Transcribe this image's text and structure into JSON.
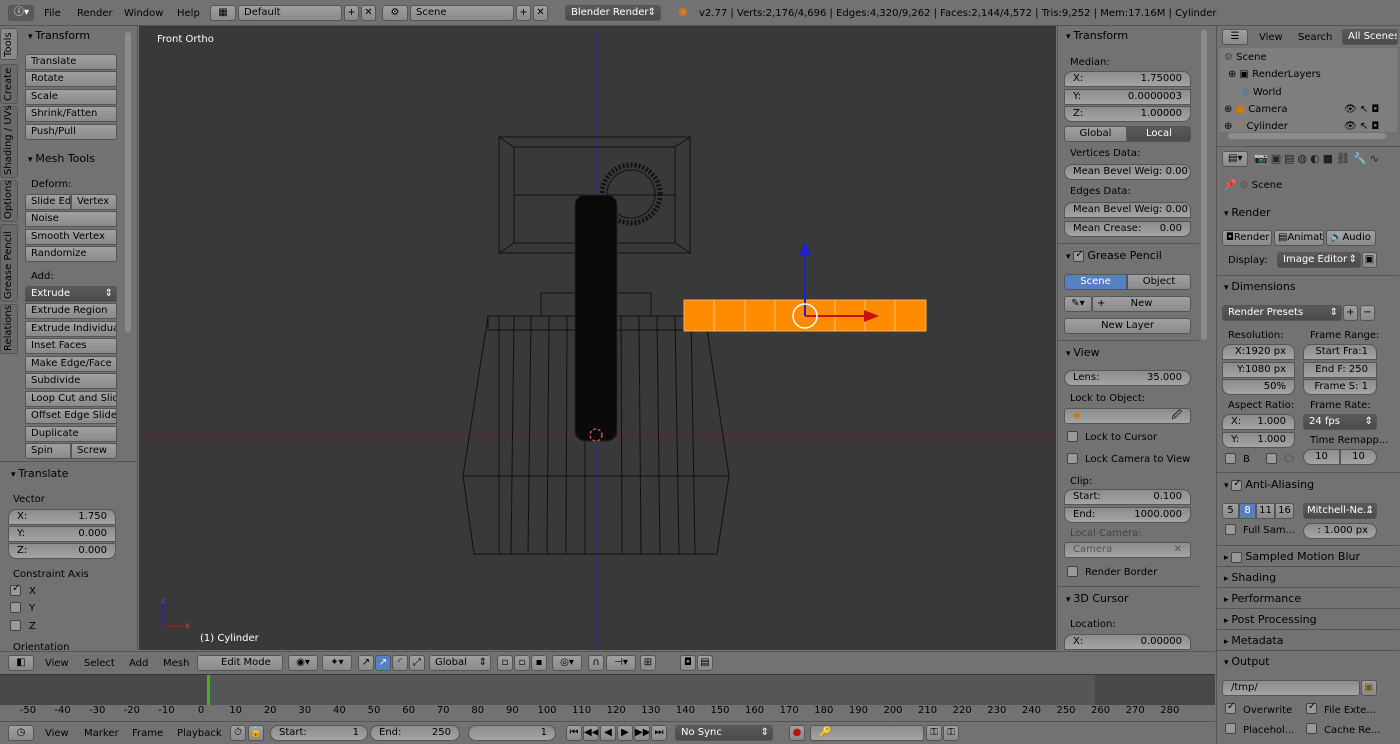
{
  "topbar": {
    "menus": [
      "File",
      "Render",
      "Window",
      "Help"
    ],
    "layout": "Default",
    "scene": "Scene",
    "engine": "Blender Render",
    "stats": "v2.77 | Verts:2,176/4,696 | Edges:4,320/9,262 | Faces:2,144/4,572 | Tris:9,252 | Mem:17.16M | Cylinder"
  },
  "tabs": [
    "Tools",
    "Create",
    "Shading / UVs",
    "Options",
    "Grease Pencil",
    "Relations"
  ],
  "tools": {
    "transform_title": "Transform",
    "transform_buttons": [
      "Translate",
      "Rotate",
      "Scale",
      "Shrink/Fatten",
      "Push/Pull"
    ],
    "mesh_title": "Mesh Tools",
    "deform_label": "Deform:",
    "slide_edge": "Slide Ed",
    "vertex": "Vertex",
    "noise": "Noise",
    "smooth": "Smooth Vertex",
    "randomize": "Randomize",
    "add_label": "Add:",
    "extrude": "Extrude",
    "add_buttons": [
      "Extrude Region",
      "Extrude Individual",
      "Inset Faces",
      "Make Edge/Face",
      "Subdivide",
      "Loop Cut and Slide",
      "Offset Edge Slide",
      "Duplicate"
    ],
    "spin": "Spin",
    "screw": "Screw"
  },
  "operator": {
    "title": "Translate",
    "vector_label": "Vector",
    "x_label": "X:",
    "x": "1.750",
    "y_label": "Y:",
    "y": "0.000",
    "z_label": "Z:",
    "z": "0.000",
    "constraint_label": "Constraint Axis",
    "cx": "X",
    "cy": "Y",
    "cz": "Z",
    "orientation": "Orientation"
  },
  "viewport": {
    "view_name": "Front Ortho",
    "object_label": "(1) Cylinder",
    "axis_z": "z",
    "axis_x": "x"
  },
  "viewheader": {
    "menus": [
      "View",
      "Select",
      "Add",
      "Mesh"
    ],
    "mode": "Edit Mode",
    "orientation": "Global"
  },
  "props": {
    "transform_title": "Transform",
    "median": "Median:",
    "x_label": "X:",
    "x": "1.75000",
    "y_label": "Y:",
    "y": "0.0000003",
    "z_label": "Z:",
    "z": "1.00000",
    "global": "Global",
    "local": "Local",
    "vertices_data": "Vertices Data:",
    "mean_bevel_v": "Mean Bevel Weig: 0.00",
    "edges_data": "Edges Data:",
    "mean_bevel_e": "Mean Bevel Weig: 0.00",
    "mean_crease_label": "Mean Crease:",
    "mean_crease": "0.00",
    "grease_title": "Grease Pencil",
    "scene_btn": "Scene",
    "object_btn": "Object",
    "new": "New",
    "new_layer": "New Layer",
    "view_title": "View",
    "lens_label": "Lens:",
    "lens": "35.000",
    "lock_object": "Lock to Object:",
    "lock_cursor": "Lock to Cursor",
    "lock_camera": "Lock Camera to View",
    "clip": "Clip:",
    "start_label": "Start:",
    "start": "0.100",
    "end_label": "End:",
    "end": "1000.000",
    "local_camera": "Local Camera:",
    "camera": "Camera",
    "render_border": "Render Border",
    "cursor_title": "3D Cursor",
    "location": "Location:",
    "cx_label": "X:",
    "cx": "0.00000"
  },
  "outliner": {
    "menus": [
      "View",
      "Search"
    ],
    "all_scenes": "All Scenes",
    "items": [
      "Scene",
      "RenderLayers",
      "World",
      "Camera",
      "Cylinder"
    ]
  },
  "render": {
    "scene": "Scene",
    "render_title": "Render",
    "render_btn": "Render",
    "anim_btn": "Animati",
    "audio_btn": "Audio",
    "display_label": "Display:",
    "display": "Image Editor",
    "dimensions_title": "Dimensions",
    "presets": "Render Presets",
    "resolution": "Resolution:",
    "res_x": "X:1920 px",
    "res_y": "Y:1080 px",
    "res_pct": "50%",
    "frame_range": "Frame Range:",
    "start_frame": "Start Fra:1",
    "end_frame": "End F: 250",
    "frame_step": "Frame S: 1",
    "aspect": "Aspect Ratio:",
    "asp_x_label": "X:",
    "asp_x": "1.000",
    "asp_y_label": "Y:",
    "asp_y": "1.000",
    "frame_rate": "Frame Rate:",
    "fps": "24 fps",
    "time_remap": "Time Remapp...",
    "remap_old": "10",
    "remap_new": "10",
    "b": "B",
    "cr": "Cr",
    "aa_title": "Anti-Aliasing",
    "aa_samples": [
      "5",
      "8",
      "11",
      "16"
    ],
    "aa_filter": "Mitchell-Ne...",
    "full_sample": "Full Sam...",
    "filter_size": ": 1.000 px",
    "smb": "Sampled Motion Blur",
    "shading": "Shading",
    "performance": "Performance",
    "post": "Post Processing",
    "metadata": "Metadata",
    "output": "Output",
    "path": "/tmp/",
    "overwrite": "Overwrite",
    "file_ext": "File Exte...",
    "placeholders": "Placehol...",
    "cache": "Cache Re..."
  },
  "timeline": {
    "ticks": [
      "-50",
      "-40",
      "-30",
      "-20",
      "-10",
      "0",
      "10",
      "20",
      "30",
      "40",
      "50",
      "60",
      "70",
      "80",
      "90",
      "100",
      "110",
      "120",
      "130",
      "140",
      "150",
      "160",
      "170",
      "180",
      "190",
      "200",
      "210",
      "220",
      "230",
      "240",
      "250",
      "260",
      "270",
      "280"
    ],
    "menus": [
      "View",
      "Marker",
      "Frame",
      "Playback"
    ],
    "start_label": "Start:",
    "start": "1",
    "end_label": "End:",
    "end": "250",
    "current": "1",
    "sync": "No Sync"
  },
  "colors": {
    "viewport": "#393939",
    "selection": "#ff8c00",
    "accent": "#5680c2"
  }
}
